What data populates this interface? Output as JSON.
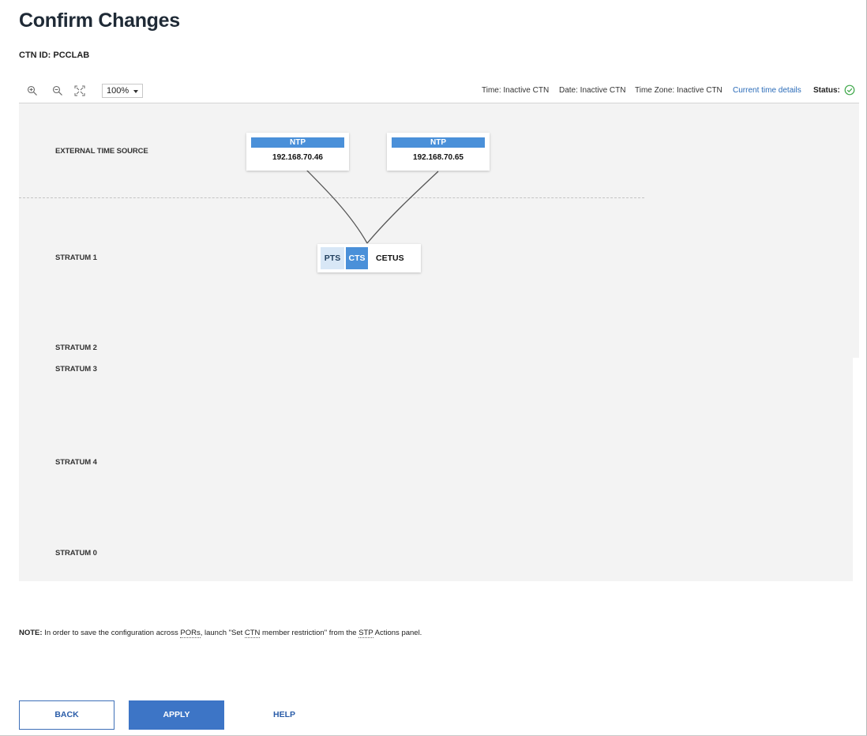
{
  "page": {
    "title": "Confirm Changes",
    "ctn_id": "CTN ID: PCCLAB"
  },
  "toolbar": {
    "zoom_in_icon": "zoom-in-icon",
    "zoom_out_icon": "zoom-out-icon",
    "fit_icon": "fit-to-screen-icon",
    "zoom_value": "100%",
    "time": "Time: Inactive CTN",
    "date": "Date: Inactive CTN",
    "time_zone": "Time Zone: Inactive CTN",
    "current_time_link": "Current time details",
    "status_label": "Status:",
    "status_icon": "check-circle-icon",
    "status_color": "#3fa84a"
  },
  "topology": {
    "rows": [
      "EXTERNAL TIME SOURCE",
      "STRATUM 1",
      "STRATUM 2",
      "STRATUM 3",
      "STRATUM 4",
      "STRATUM 0"
    ],
    "ntp_servers": [
      {
        "type": "NTP",
        "ip": "192.168.70.46"
      },
      {
        "type": "NTP",
        "ip": "192.168.70.65"
      }
    ],
    "server": {
      "pts_badge": "PTS",
      "cts_badge": "CTS",
      "name": "CETUS"
    },
    "accent_color": "#4a90d9"
  },
  "note": {
    "prefix": "NOTE:",
    "text_1": " In order to save the configuration across ",
    "pors": "PORs",
    "text_2": ", launch \"Set ",
    "ctn": "CTN",
    "text_3": " member restriction\" from the ",
    "stp": "STP",
    "text_4": " Actions panel."
  },
  "buttons": {
    "back": "BACK",
    "apply": "APPLY",
    "help": "HELP"
  }
}
